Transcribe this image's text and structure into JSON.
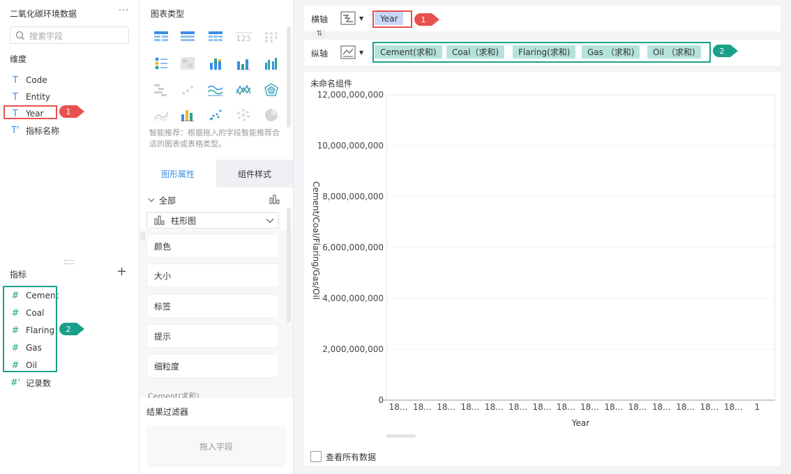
{
  "dataset": {
    "title": "二氧化碳环境数据",
    "more": "···"
  },
  "search": {
    "placeholder": "搜索字段"
  },
  "dimensions": {
    "title": "维度",
    "items": [
      {
        "icon": "T",
        "label": "Code"
      },
      {
        "icon": "T",
        "label": "Entity"
      },
      {
        "icon": "T",
        "label": "Year"
      },
      {
        "icon": "T'",
        "label": "指标名称"
      }
    ]
  },
  "measures": {
    "title": "指标",
    "add": "+",
    "items": [
      {
        "icon": "#",
        "label": "Cement"
      },
      {
        "icon": "#",
        "label": "Coal"
      },
      {
        "icon": "#",
        "label": "Flaring"
      },
      {
        "icon": "#",
        "label": "Gas"
      },
      {
        "icon": "#",
        "label": "Oil"
      },
      {
        "icon": "#'",
        "label": "记录数"
      }
    ]
  },
  "chart_types": {
    "title": "图表类型",
    "hint": "智能推荐：根据拖入的字段智能推荐合适的图表或表格类型。",
    "number_icon": "123"
  },
  "tabs": {
    "active": "图形属性",
    "inactive": "组件样式"
  },
  "props": {
    "all": "全部",
    "chart_type": "柱形图",
    "items": [
      "颜色",
      "大小",
      "标签",
      "提示",
      "细粒度"
    ],
    "series_row": "Cement(求和)"
  },
  "filter": {
    "title": "结果过滤器",
    "drop": "拖入字段"
  },
  "x_axis": {
    "label": "横轴",
    "field": "Year"
  },
  "y_axis": {
    "label": "纵轴",
    "fields": [
      "Cement(求和)",
      "Coal（求和)",
      "Flaring(求和)",
      "Gas （求和)",
      "Oil （求和)"
    ]
  },
  "swap_icon": "⇅",
  "badges": {
    "one": "1",
    "two": "2"
  },
  "chart_card": {
    "title": "未命名组件",
    "show_all": "查看所有数据"
  },
  "colors": {
    "red": "#e8514f",
    "green": "#1aa088",
    "blue_accent": "#3a8ee6",
    "pill_x": "#c9d6f5",
    "pill_y": "#b5e3dc"
  },
  "chart_data": {
    "type": "bar",
    "xlabel": "Year",
    "ylabel": "Cement/Coal/Flaring/Gas/Oil",
    "ylim": [
      0,
      12000000000
    ],
    "y_ticks": [
      "12,000,000,000",
      "10,000,000,000",
      "8,000,000,000",
      "6,000,000,000",
      "4,000,000,000",
      "2,000,000,000",
      "0"
    ],
    "x_tick_labels": [
      "18...",
      "18...",
      "18...",
      "18...",
      "18...",
      "18...",
      "18...",
      "18...",
      "18...",
      "18...",
      "18...",
      "18...",
      "18...",
      "18...",
      "18...",
      "1"
    ],
    "series": []
  }
}
